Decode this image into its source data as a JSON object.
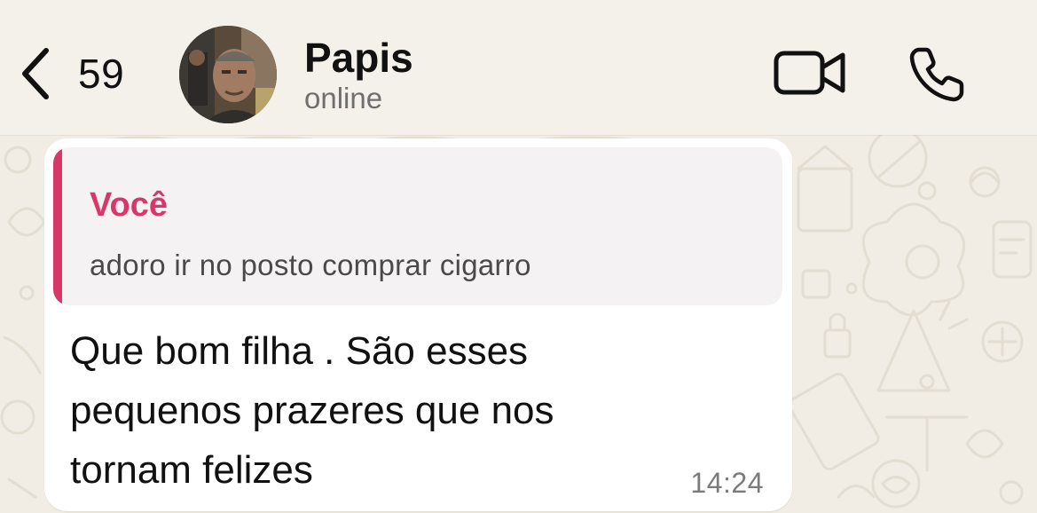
{
  "header": {
    "back_count": "59",
    "contact_name": "Papis",
    "contact_status": "online",
    "icons": {
      "back": "chevron-left-icon",
      "video": "video-camera-icon",
      "call": "phone-icon"
    }
  },
  "message": {
    "quote": {
      "author": "Você",
      "text": "adoro ir no posto comprar cigarro",
      "accent_color": "#d8376a"
    },
    "text": "Que bom filha . São esses pequenos prazeres que nos tornam felizes",
    "time": "14:24"
  },
  "colors": {
    "header_bg": "#f4f1ea",
    "wallpaper_bg": "#f1ece4",
    "bubble_bg": "#ffffff",
    "quote_bg": "#f4f2f3"
  }
}
